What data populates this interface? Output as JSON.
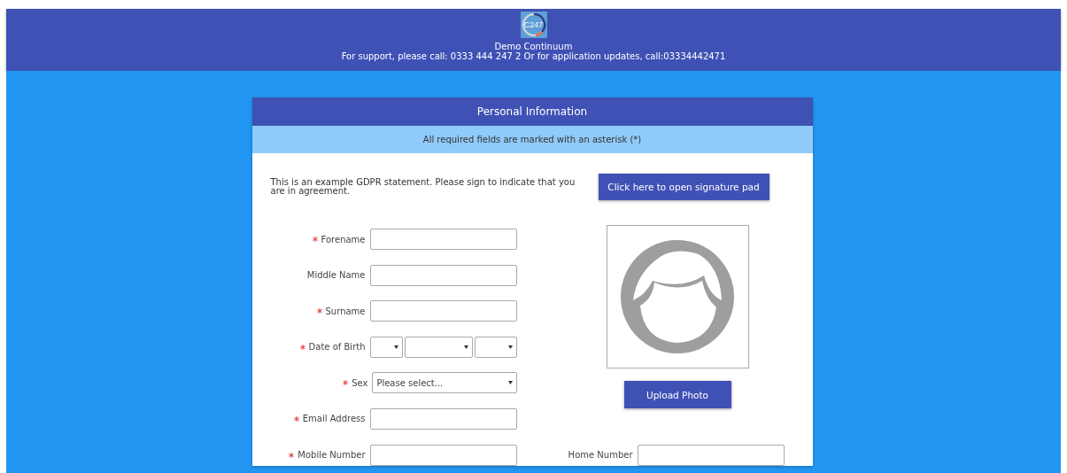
{
  "header": {
    "logo_text": "C247",
    "title": "Demo Continuum",
    "support": "For support, please call: 0333 444 247 2 Or for application updates, call:03334442471"
  },
  "card": {
    "title": "Personal Information",
    "notice": "All required fields are marked with an asterisk (*)"
  },
  "gdpr": {
    "statement": "This is an example GDPR statement. Please sign to indicate that you are in agreement.",
    "button": "Click here to open signature pad"
  },
  "fields": [
    {
      "kind": "text",
      "label": "Forename",
      "required": true
    },
    {
      "kind": "text",
      "label": "Middle Name",
      "required": false
    },
    {
      "kind": "text",
      "label": "Surname",
      "required": true
    },
    {
      "kind": "date",
      "label": "Date of Birth",
      "required": true
    },
    {
      "kind": "select",
      "label": "Sex",
      "required": true,
      "value": "Please select..."
    },
    {
      "kind": "text",
      "label": "Email Address",
      "required": true
    }
  ],
  "phone_row": [
    {
      "kind": "text",
      "label": "Mobile Number",
      "required": true
    },
    {
      "kind": "text",
      "label": "Home Number",
      "required": false
    }
  ],
  "photo": {
    "button": "Upload Photo"
  }
}
